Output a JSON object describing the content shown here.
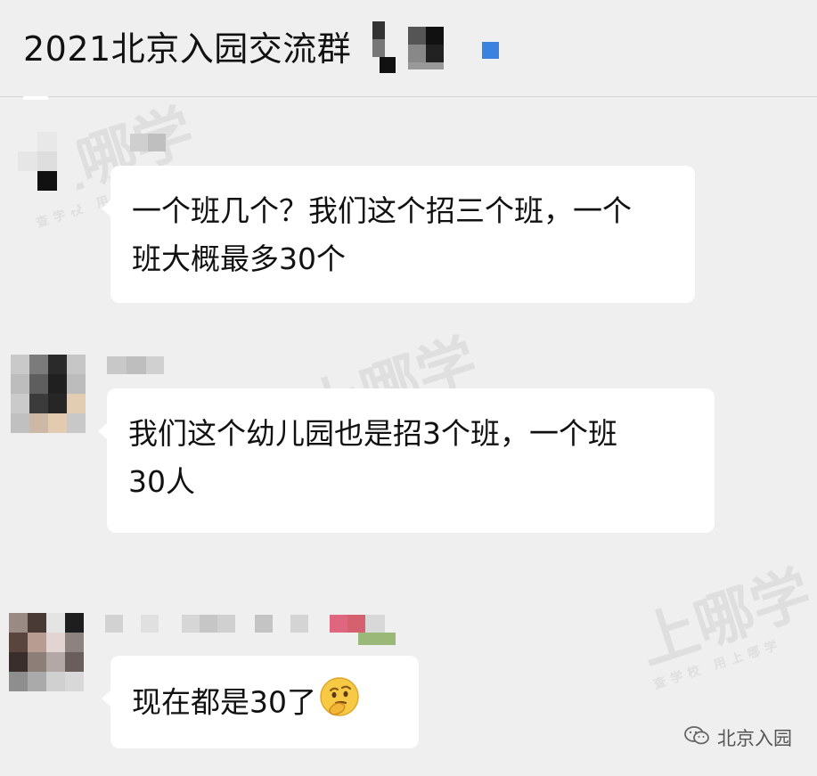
{
  "header": {
    "title": "2021北京入园交流群"
  },
  "watermark": {
    "brand": "上哪学",
    "tagline": "查学校 用上哪学"
  },
  "messages": [
    {
      "text_lines": [
        "一个班几个？我们这个招三个班，一个",
        "班大概最多30个"
      ]
    },
    {
      "text_lines": [
        "我们这个幼儿园也是招3个班，一个班",
        "30人"
      ]
    },
    {
      "text": "现在都是30了",
      "emoji": "thinking-face-emoji"
    }
  ],
  "footer": {
    "label": "北京入园",
    "icon": "wechat-icon"
  },
  "colors": {
    "background": "#efefef",
    "bubble": "#ffffff",
    "accent": "#3b82e0"
  }
}
